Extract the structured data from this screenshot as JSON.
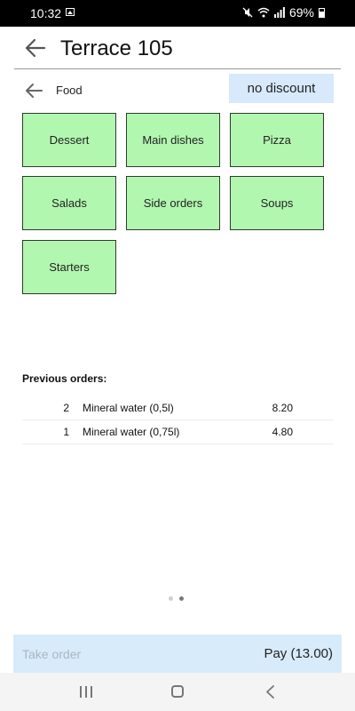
{
  "status_bar": {
    "time": "10:32",
    "battery": "69%",
    "icons": [
      "image-icon",
      "mute-icon",
      "wifi-icon",
      "signal-icon",
      "battery-icon"
    ]
  },
  "header": {
    "title": "Terrace 105",
    "back_icon": "arrow-left-icon"
  },
  "category": {
    "label": "Food",
    "discount_label": "no discount"
  },
  "tiles": [
    {
      "label": "Dessert"
    },
    {
      "label": "Main dishes"
    },
    {
      "label": "Pizza"
    },
    {
      "label": "Salads"
    },
    {
      "label": "Side orders"
    },
    {
      "label": "Soups"
    },
    {
      "label": "Starters"
    }
  ],
  "tile_color": "#b2f7b0",
  "previous_orders": {
    "title": "Previous orders:",
    "items": [
      {
        "qty": "2",
        "name": "Mineral water (0,5l)",
        "price": "8.20"
      },
      {
        "qty": "1",
        "name": "Mineral water (0,75l)",
        "price": "4.80"
      }
    ]
  },
  "pager": {
    "pages": 2,
    "current": 2
  },
  "actions": {
    "take_order": "Take order",
    "pay": "Pay (13.00)"
  },
  "accent_color": "#d8ebfb",
  "nav_bar": [
    "recent-apps-icon",
    "home-icon",
    "back-icon"
  ]
}
